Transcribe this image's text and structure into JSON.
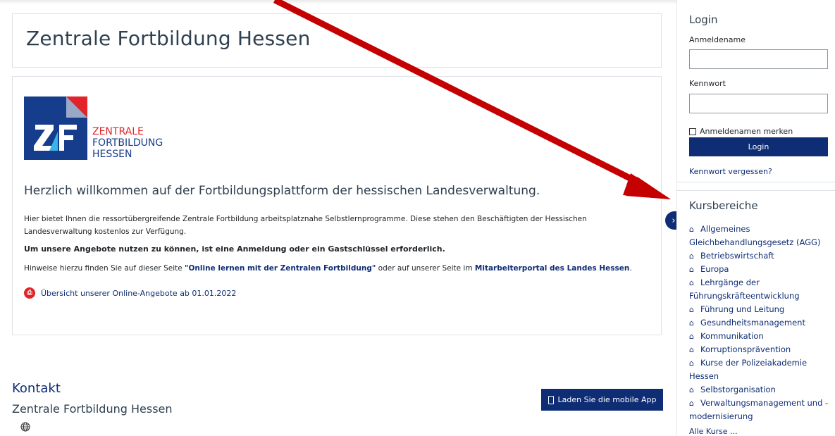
{
  "main": {
    "title": "Zentrale Fortbildung Hessen",
    "logo": {
      "line1": "ZENTRALE",
      "line2": "FORTBILDUNG",
      "line3": "HESSEN"
    },
    "welcome": "Herzlich willkommen auf der Fortbildungsplattform der hessischen Landesverwaltung.",
    "intro": "Hier bietet Ihnen die ressortübergreifende Zentrale Fortbildung arbeitsplatznahe Selbstlernprogramme. Diese stehen den Beschäftigten der Hessischen Landesverwaltung kostenlos zur Verfügung.",
    "notice": "Um unsere Angebote nutzen zu können, ist eine Anmeldung oder ein Gastschlüssel erforderlich.",
    "hint": {
      "prefix": "Hinweise hierzu finden Sie auf dieser Seite ",
      "link1": "\"Online lernen mit der Zentralen Fortbildung\"",
      "middle": " oder auf unserer Seite im ",
      "link2": "Mitarbeiterportal des Landes Hessen",
      "suffix": "."
    },
    "pdf_link": "Übersicht unserer Online-Angebote ab 01.01.2022"
  },
  "footer": {
    "kontakt_heading": "Kontakt",
    "organization": "Zentrale Fortbildung Hessen",
    "mobile_app_label": "Laden Sie die mobile App"
  },
  "login": {
    "title": "Login",
    "username_label": "Anmeldename",
    "username_value": "",
    "password_label": "Kennwort",
    "password_value": "",
    "remember_label": "Anmeldenamen merken",
    "remember_checked": false,
    "submit_label": "Login",
    "forgot_label": "Kennwort vergessen?"
  },
  "courses": {
    "title": "Kursbereiche",
    "items": [
      "Allgemeines Gleichbehandlungsgesetz (AGG)",
      "Betriebswirtschaft",
      "Europa",
      "Lehrgänge der Führungskräfteentwicklung",
      "Führung und Leitung",
      "Gesundheitsmanagement",
      "Kommunikation",
      "Korruptionsprävention",
      "Kurse der Polizeiakademie Hessen",
      "Selbstorganisation",
      "Verwaltungsmanagement und -modernisierung"
    ],
    "all_courses_label": "Alle Kurse ..."
  },
  "icons": {
    "course_icon": "graduation-cap-icon",
    "pdf_icon": "pdf-icon",
    "footer_icon": "globe-icon",
    "drawer_toggle_icon": "chevron-right-icon",
    "mobile_icon": "phone-icon"
  },
  "colors": {
    "brand_blue": "#0f2d74",
    "brand_red": "#e2232a",
    "annotation_arrow": "#c40000"
  }
}
